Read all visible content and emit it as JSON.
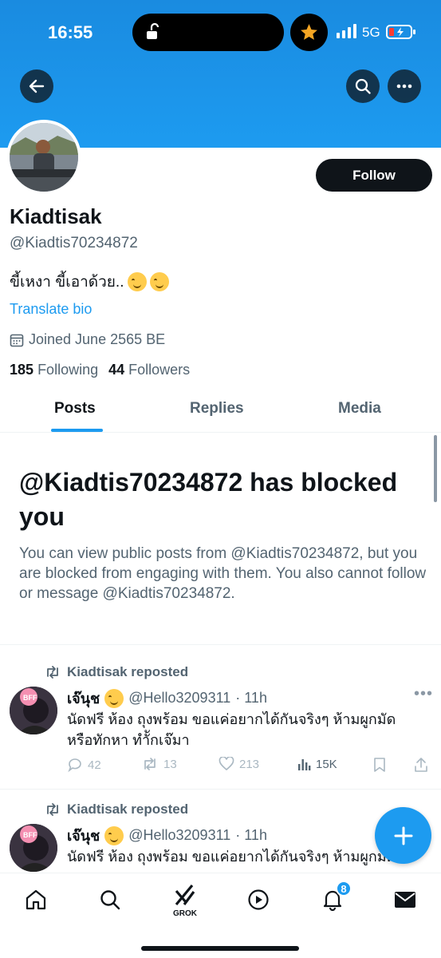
{
  "status_bar": {
    "time": "16:55",
    "network": "5G"
  },
  "profile": {
    "name": "Kiadtisak",
    "handle": "@Kiadtis70234872",
    "bio": "ขี้เหงา ขี้เอาด้วย..",
    "translate_label": "Translate bio",
    "joined": "Joined June 2565 BE",
    "following_count": "185",
    "following_label": "Following",
    "followers_count": "44",
    "followers_label": "Followers",
    "follow_button": "Follow"
  },
  "tabs": [
    {
      "label": "Posts",
      "active": true
    },
    {
      "label": "Replies",
      "active": false
    },
    {
      "label": "Media",
      "active": false
    }
  ],
  "blocked": {
    "title": "@Kiadtis70234872 has blocked you",
    "message": "You can view public posts from @Kiadtis70234872, but you are blocked from engaging with them. You also cannot follow or message @Kiadtis70234872."
  },
  "posts": [
    {
      "repost_label": "Kiadtisak reposted",
      "author_name": "เจ๊นุช",
      "author_handle": "@Hello3209311",
      "time": "· 11h",
      "text_line1": "นัดฟรี ห้อง ถุงพร้อม  ขอแค่อยากได้กันจริงๆ ห้ามผูกมัด",
      "text_line2": "หรือทักหา ทำัักเจ๊มา",
      "replies": "42",
      "reposts": "13",
      "likes": "213",
      "views": "15K"
    },
    {
      "repost_label": "Kiadtisak reposted",
      "author_name": "เจ๊นุช",
      "author_handle": "@Hello3209311",
      "time": "· 11h",
      "text_line1": "นัดฟรี ห้อง ถุงพร้อม  ขอแค่อยากได้กันจริงๆ ห้ามผูกมัด"
    }
  ],
  "nav": {
    "grok_label": "GROK",
    "notifications_badge": "8"
  },
  "colors": {
    "accent": "#1d9bf0",
    "text": "#0f1419",
    "muted": "#536471"
  }
}
